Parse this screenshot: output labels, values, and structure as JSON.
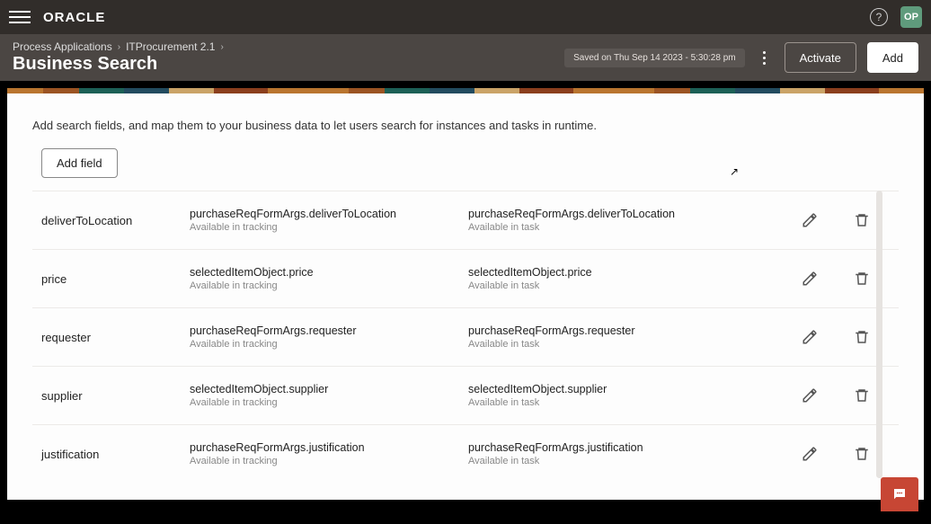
{
  "topbar": {
    "logo": "ORACLE",
    "avatar": "OP"
  },
  "breadcrumbs": {
    "item1": "Process Applications",
    "item2": "ITProcurement 2.1"
  },
  "page_title": "Business Search",
  "saved_text": "Saved on Thu Sep 14 2023 - 5:30:28 pm",
  "buttons": {
    "activate": "Activate",
    "add": "Add",
    "add_field": "Add field"
  },
  "hint": "Add search fields, and map them to your business data to let users search for instances and tasks in runtime.",
  "labels": {
    "avail_tracking": "Available in tracking",
    "avail_task": "Available in task"
  },
  "rows": [
    {
      "name": "deliverToLocation",
      "tracking": "purchaseReqFormArgs.deliverToLocation",
      "task": "purchaseReqFormArgs.deliverToLocation"
    },
    {
      "name": "price",
      "tracking": "selectedItemObject.price",
      "task": "selectedItemObject.price"
    },
    {
      "name": "requester",
      "tracking": "purchaseReqFormArgs.requester",
      "task": "purchaseReqFormArgs.requester"
    },
    {
      "name": "supplier",
      "tracking": "selectedItemObject.supplier",
      "task": "selectedItemObject.supplier"
    },
    {
      "name": "justification",
      "tracking": "purchaseReqFormArgs.justification",
      "task": "purchaseReqFormArgs.justification"
    }
  ]
}
